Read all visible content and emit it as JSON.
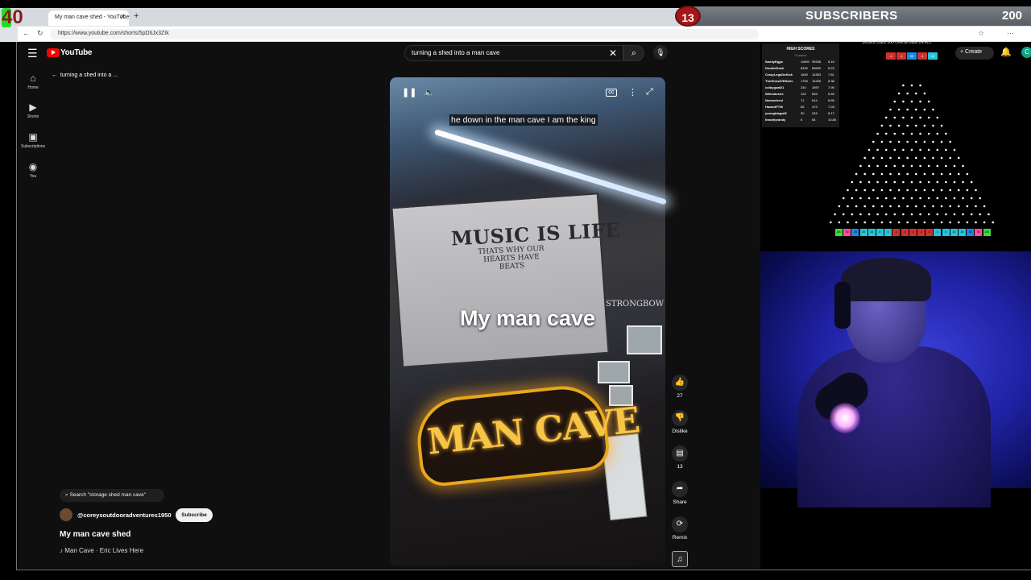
{
  "overlay": {
    "timer": "40",
    "subscribers": {
      "count": "13",
      "label": "SUBSCRIBERS",
      "goal": "200"
    },
    "high_scores": {
      "title": "HIGH SCORES",
      "subtitle": "Channel",
      "rows": [
        {
          "name": "SandyEggo",
          "a": "11690",
          "b": "95338",
          "c": "8.16"
        },
        {
          "name": "DoobieDuck",
          "a": "8320",
          "b": "68500",
          "c": "8.23"
        },
        {
          "name": "CrazyLegsDoKick",
          "a": "1840",
          "b": "14363",
          "c": "7.81"
        },
        {
          "name": "TheGhostOfHister",
          "a": "1700",
          "b": "14205",
          "c": "8.36"
        },
        {
          "name": "colbygoat21",
          "a": "240",
          "b": "1897",
          "c": "7.90"
        },
        {
          "name": "Whimdesire",
          "a": "122",
          "b": "833",
          "c": "6.83"
        },
        {
          "name": "Nemoeternl",
          "a": "71",
          "b": "614",
          "c": "8.65"
        },
        {
          "name": "HazardFTW",
          "a": "65",
          "b": "473",
          "c": "7.28"
        },
        {
          "name": "youngblagwill",
          "a": "30",
          "b": "245",
          "c": "8.17"
        },
        {
          "name": "timothyrandy",
          "a": "5",
          "b": "54",
          "c": "10.80"
        }
      ]
    },
    "session": "Session Balls  300    Overall Balls  24,423",
    "chips": [
      "-1",
      "-1",
      "35",
      "-1",
      "10"
    ],
    "slots": [
      "100",
      "50",
      "35",
      "20",
      "15",
      "5",
      "1",
      "-1",
      "-1",
      "-1",
      "-1",
      "-1",
      "1",
      "5",
      "15",
      "20",
      "35",
      "50",
      "100"
    ]
  },
  "browser": {
    "tab_title": "My man cave shed - YouTube",
    "url": "https://www.youtube.com/shorts/5pDtiJx3ZIk"
  },
  "youtube": {
    "logo": "YouTube",
    "search_query": "turning a shed into a man cave",
    "create_label": "Create",
    "avatar_letter": "C",
    "sidebar": [
      {
        "label": "Home",
        "icon": "home-icon"
      },
      {
        "label": "Shorts",
        "icon": "shorts-icon"
      },
      {
        "label": "Subscriptions",
        "icon": "subscriptions-icon"
      },
      {
        "label": "You",
        "icon": "you-icon"
      }
    ],
    "back_label": "turning a shed into a ...",
    "video": {
      "subtitle": "he down in the man cave I am the king",
      "overlay_title": "My man cave",
      "poster_line1": "MUSIC IS LIFE",
      "poster_line2": "THATS WHY OUR HEARTS HAVE BEATS",
      "strongbow": "STRONGBOW",
      "neon": "MAN CAVE",
      "cc": "CC"
    },
    "actions": {
      "like_count": "27",
      "dislike_label": "Dislike",
      "comment_count": "13",
      "share_label": "Share",
      "remix_label": "Remix"
    },
    "related_search": "Search \"storage shed man cave\"",
    "channel_name": "@coreysoutdooradventures1950",
    "subscribe_label": "Subscribe",
    "short_title": "My man cave shed",
    "music": "Man Cave · Eric Lives Here"
  }
}
